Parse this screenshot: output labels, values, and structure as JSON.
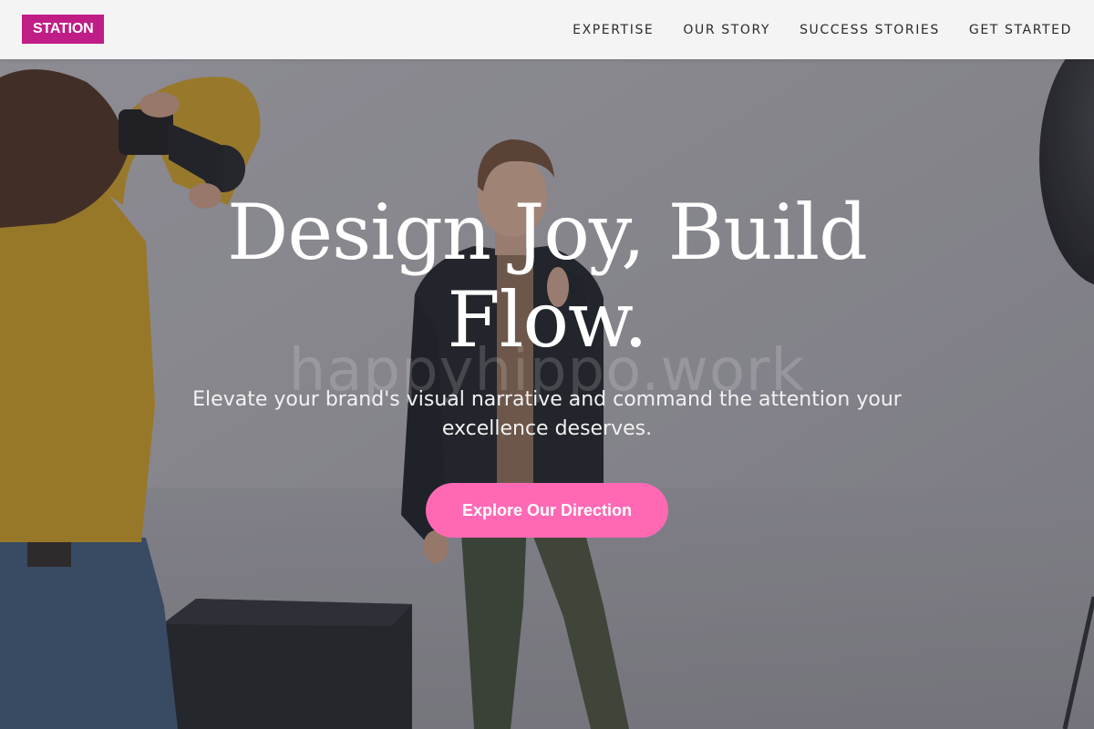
{
  "header": {
    "logo_text": "STATION",
    "nav": [
      {
        "label": "EXPERTISE"
      },
      {
        "label": "OUR STORY"
      },
      {
        "label": "SUCCESS STORIES"
      },
      {
        "label": "GET STARTED"
      }
    ]
  },
  "hero": {
    "headline": "Design Joy, Build Flow.",
    "watermark": "happyhippo.work",
    "subheadline": "Elevate your brand's visual narrative and command the attention your excellence deserves.",
    "cta_label": "Explore Our Direction"
  },
  "colors": {
    "brand": "#c01d86",
    "cta": "#ff69b4",
    "header_bg": "#f4f4f4"
  }
}
